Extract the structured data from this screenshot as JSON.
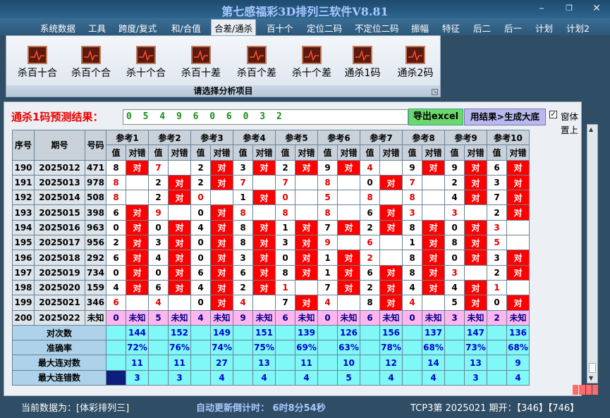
{
  "window": {
    "title": "第七感福彩3D排列三软件V8.81"
  },
  "menu": [
    "系统数据",
    "工具",
    "跨度/复式",
    "和/合值",
    "合差/通杀",
    "百十个",
    "定位二码",
    "不定位二码",
    "振幅",
    "特征",
    "后二",
    "后一",
    "计划",
    "计划2"
  ],
  "menu_active": 4,
  "ribbon": {
    "items": [
      "杀百十合",
      "杀百个合",
      "杀十个合",
      "杀百十差",
      "杀百个差",
      "杀十个差",
      "通杀1码",
      "通杀2码"
    ],
    "footer": "请选择分析项目"
  },
  "prediction": {
    "label": "通杀1码预测结果：",
    "value": "0 5 4 9 6 0 6 0 3 2",
    "export_button": "导出excel",
    "generate_button": "用结果>生成大底",
    "on_top_label": "窗体置上",
    "on_top_checked": true
  },
  "table": {
    "col_seq": "序号",
    "col_period": "期号",
    "col_number": "号码",
    "ref_headers": [
      "参考1",
      "参考2",
      "参考3",
      "参考4",
      "参考5",
      "参考6",
      "参考7",
      "参考8",
      "参考9",
      "参考10"
    ],
    "sub_value": "值",
    "sub_result": "对错",
    "right_mark": "对",
    "unknown_mark": "未知",
    "rows": [
      {
        "seq": "190",
        "period": "2025012",
        "num": "471",
        "vals": [
          "8",
          "7",
          "2",
          "3",
          "2",
          "9",
          "4",
          "9",
          "9",
          "6"
        ],
        "hits": [
          1,
          0,
          1,
          1,
          1,
          1,
          0,
          1,
          1,
          1
        ],
        "redv": [
          0,
          1,
          0,
          0,
          0,
          0,
          1,
          0,
          0,
          0
        ]
      },
      {
        "seq": "191",
        "period": "2025013",
        "num": "978",
        "vals": [
          "8",
          "2",
          "2",
          "7",
          "7",
          "8",
          "0",
          "7",
          "2",
          "3"
        ],
        "hits": [
          0,
          1,
          1,
          0,
          0,
          0,
          1,
          0,
          1,
          1
        ],
        "redv": [
          1,
          0,
          0,
          1,
          1,
          1,
          0,
          1,
          0,
          0
        ]
      },
      {
        "seq": "192",
        "period": "2025014",
        "num": "508",
        "vals": [
          "8",
          "2",
          "0",
          "1",
          "0",
          "5",
          "8",
          "8",
          "4",
          "7"
        ],
        "hits": [
          0,
          1,
          0,
          1,
          0,
          0,
          0,
          0,
          1,
          1
        ],
        "redv": [
          1,
          0,
          1,
          0,
          1,
          1,
          1,
          1,
          0,
          0
        ]
      },
      {
        "seq": "193",
        "period": "2025015",
        "num": "398",
        "vals": [
          "6",
          "9",
          "0",
          "8",
          "8",
          "8",
          "6",
          "3",
          "3",
          "2"
        ],
        "hits": [
          1,
          0,
          1,
          0,
          0,
          0,
          1,
          0,
          0,
          1
        ],
        "redv": [
          0,
          1,
          0,
          1,
          1,
          1,
          0,
          1,
          1,
          0
        ]
      },
      {
        "seq": "194",
        "period": "2025016",
        "num": "963",
        "vals": [
          "0",
          "0",
          "4",
          "8",
          "1",
          "7",
          "2",
          "8",
          "0",
          "3"
        ],
        "hits": [
          1,
          1,
          1,
          1,
          1,
          1,
          1,
          1,
          1,
          0
        ],
        "redv": [
          0,
          0,
          0,
          0,
          0,
          0,
          0,
          0,
          0,
          1
        ]
      },
      {
        "seq": "195",
        "period": "2025017",
        "num": "956",
        "vals": [
          "2",
          "3",
          "0",
          "8",
          "3",
          "9",
          "6",
          "1",
          "8",
          "5"
        ],
        "hits": [
          1,
          1,
          1,
          1,
          1,
          0,
          0,
          1,
          1,
          0
        ],
        "redv": [
          0,
          0,
          0,
          0,
          0,
          1,
          1,
          0,
          0,
          1
        ]
      },
      {
        "seq": "196",
        "period": "2025018",
        "num": "292",
        "vals": [
          "6",
          "4",
          "0",
          "3",
          "0",
          "1",
          "2",
          "8",
          "0",
          "3"
        ],
        "hits": [
          1,
          1,
          1,
          1,
          1,
          1,
          0,
          1,
          1,
          1
        ],
        "redv": [
          0,
          0,
          0,
          0,
          0,
          0,
          1,
          0,
          0,
          0
        ]
      },
      {
        "seq": "197",
        "period": "2025019",
        "num": "734",
        "vals": [
          "0",
          "0",
          "6",
          "6",
          "8",
          "1",
          "6",
          "8",
          "3",
          "2"
        ],
        "hits": [
          1,
          1,
          1,
          1,
          1,
          1,
          1,
          1,
          0,
          1
        ],
        "redv": [
          0,
          0,
          0,
          0,
          0,
          0,
          0,
          0,
          1,
          0
        ]
      },
      {
        "seq": "198",
        "period": "2025020",
        "num": "159",
        "vals": [
          "4",
          "6",
          "4",
          "2",
          "1",
          "7",
          "2",
          "4",
          "4",
          "1"
        ],
        "hits": [
          1,
          1,
          1,
          1,
          0,
          1,
          1,
          1,
          1,
          0
        ],
        "redv": [
          0,
          0,
          0,
          0,
          1,
          0,
          0,
          0,
          0,
          1
        ]
      },
      {
        "seq": "199",
        "period": "2025021",
        "num": "346",
        "vals": [
          "6",
          "4",
          "0",
          "4",
          "7",
          "4",
          "8",
          "4",
          "5",
          "0"
        ],
        "hits": [
          0,
          0,
          1,
          0,
          1,
          0,
          1,
          0,
          1,
          1
        ],
        "redv": [
          1,
          1,
          0,
          1,
          0,
          1,
          0,
          1,
          0,
          0
        ]
      }
    ],
    "pending_row": {
      "seq": "200",
      "period": "2025022",
      "num": "未知",
      "vals": [
        "0",
        "5",
        "4",
        "9",
        "6",
        "0",
        "6",
        "0",
        "3",
        "2"
      ]
    },
    "stats": [
      {
        "label": "对次数",
        "values": [
          "144",
          "152",
          "149",
          "151",
          "139",
          "126",
          "156",
          "137",
          "147",
          "136"
        ]
      },
      {
        "label": "准确率",
        "values": [
          "72%",
          "76%",
          "74%",
          "75%",
          "69%",
          "63%",
          "78%",
          "68%",
          "73%",
          "68%"
        ]
      },
      {
        "label": "最大连对数",
        "values": [
          "11",
          "11",
          "27",
          "13",
          "11",
          "10",
          "12",
          "14",
          "13",
          "9"
        ]
      },
      {
        "label": "最大连错数",
        "values": [
          "3",
          "3",
          "4",
          "4",
          "4",
          "5",
          "4",
          "4",
          "3",
          "4"
        ]
      }
    ]
  },
  "status": {
    "current_data": "当前数据为：[体彩排列三]",
    "countdown": "自动更新倒计时：  6时8分54秒",
    "latest": "TCP3第 2025021 期开：【346】【746】"
  },
  "colors": {
    "hit": "#ff0000",
    "pending": "#ffb6ef",
    "stats": "#80f8f8",
    "title": "#a8c8ff"
  }
}
